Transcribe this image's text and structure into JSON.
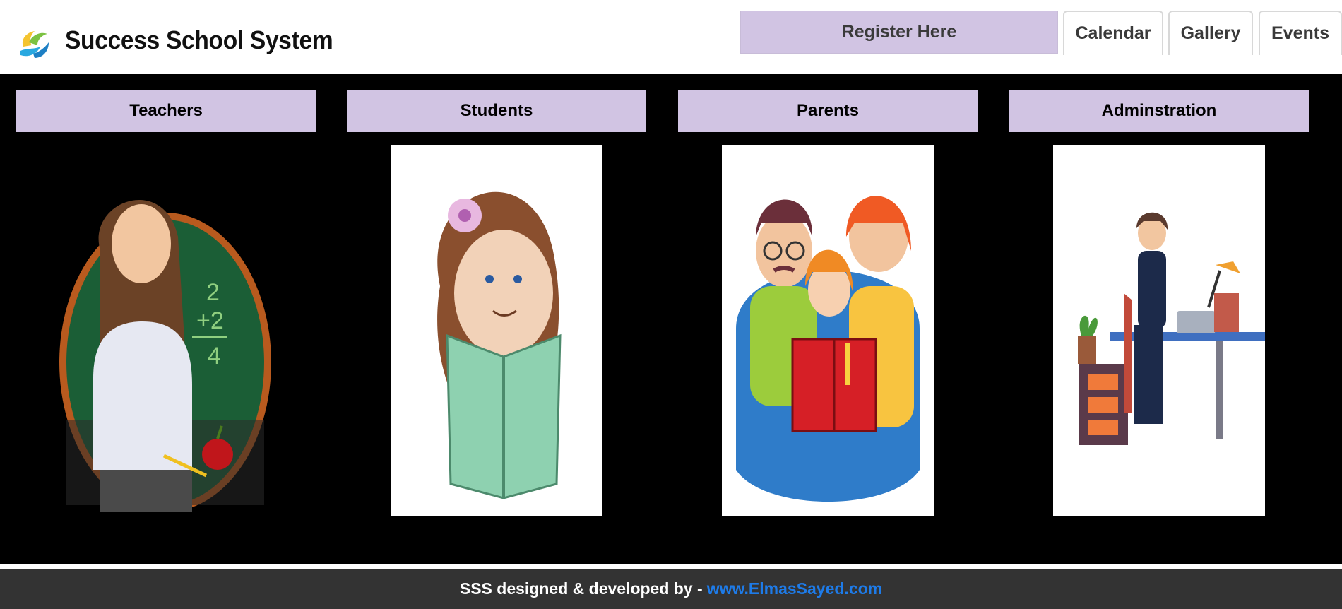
{
  "header": {
    "title": "Success School System",
    "register_label": "Register Here",
    "tabs": [
      {
        "label": "Calendar"
      },
      {
        "label": "Gallery"
      },
      {
        "label": "Events"
      }
    ]
  },
  "categories": [
    {
      "label": "Teachers"
    },
    {
      "label": "Students"
    },
    {
      "label": "Parents"
    },
    {
      "label": "Adminstration"
    }
  ],
  "footer": {
    "text": "SSS designed & developed by -",
    "link": "www.ElmasSayed.com"
  },
  "colors": {
    "button_bg": "#d1c4e3",
    "panel_bg": "#000000",
    "footer_bg": "#333333",
    "link": "#1e7be8"
  }
}
